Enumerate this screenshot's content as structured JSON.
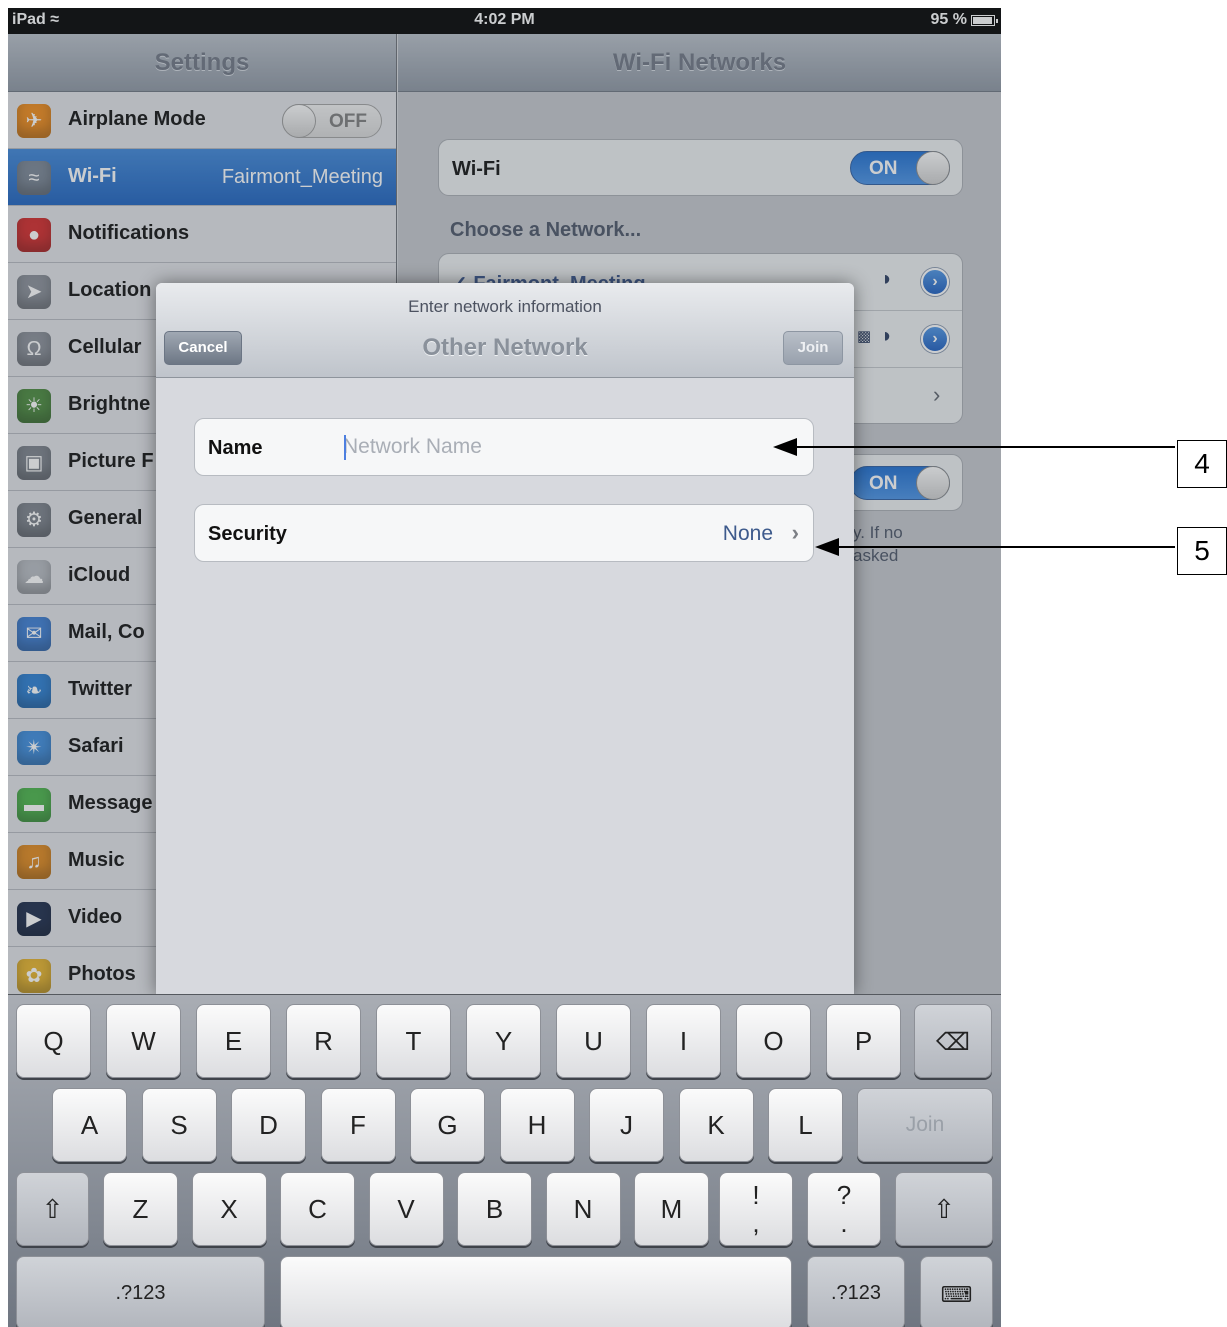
{
  "status_bar": {
    "device": "iPad",
    "time": "4:02 PM",
    "battery": "95 %"
  },
  "master": {
    "title": "Settings",
    "items": [
      {
        "label": "Airplane Mode",
        "toggle": "OFF",
        "icon": "airplane-icon",
        "color": "#f28c1a"
      },
      {
        "label": "Wi-Fi",
        "value": "Fairmont_Meeting",
        "icon": "wifi-icon",
        "color": "#7b8796",
        "selected": true
      },
      {
        "label": "Notifications",
        "icon": "notifications-icon",
        "color": "#d62a2a"
      },
      {
        "label": "Location",
        "icon": "location-icon",
        "color": "#8b9099"
      },
      {
        "label": "Cellular",
        "icon": "cellular-icon",
        "color": "#8b9099"
      },
      {
        "label": "Brightne",
        "icon": "brightness-icon",
        "color": "#4b8b3d"
      },
      {
        "label": "Picture F",
        "icon": "picture-frame-icon",
        "color": "#7d838c"
      },
      {
        "label": "General",
        "icon": "gear-icon",
        "color": "#7d838c"
      },
      {
        "label": "iCloud",
        "icon": "cloud-icon",
        "color": "#b8bcc2"
      },
      {
        "label": "Mail, Co",
        "icon": "mail-icon",
        "color": "#3d7fd6"
      },
      {
        "label": "Twitter",
        "icon": "twitter-icon",
        "color": "#2b7fd4"
      },
      {
        "label": "Safari",
        "icon": "safari-icon",
        "color": "#3e8ee0"
      },
      {
        "label": "Message",
        "icon": "messages-icon",
        "color": "#4bb64a"
      },
      {
        "label": "Music",
        "icon": "music-icon",
        "color": "#e38a1d"
      },
      {
        "label": "Video",
        "icon": "video-icon",
        "color": "#1d2c4c"
      },
      {
        "label": "Photos",
        "icon": "photos-icon",
        "color": "#e9b52b"
      }
    ]
  },
  "detail": {
    "title": "Wi-Fi Networks",
    "wifi_label": "Wi-Fi",
    "wifi_toggle": "ON",
    "choose_label": "Choose a Network...",
    "networks": [
      {
        "name": "✓ Fairmont_Meeting"
      }
    ],
    "ask_toggle": "ON",
    "footer_partial_1": "y. If no",
    "footer_partial_2": "asked"
  },
  "modal": {
    "prompt": "Enter network information",
    "title": "Other Network",
    "cancel_label": "Cancel",
    "join_label": "Join",
    "name_label": "Name",
    "name_value": "",
    "name_placeholder": "Network Name",
    "security_label": "Security",
    "security_value": "None"
  },
  "keyboard": {
    "row1": [
      "Q",
      "W",
      "E",
      "R",
      "T",
      "Y",
      "U",
      "I",
      "O",
      "P"
    ],
    "row2": [
      "A",
      "S",
      "D",
      "F",
      "G",
      "H",
      "J",
      "K",
      "L"
    ],
    "row3": [
      "Z",
      "X",
      "C",
      "V",
      "B",
      "N",
      "M"
    ],
    "punct1_top": "!",
    "punct1_bottom": ",",
    "punct2_top": "?",
    "punct2_bottom": ".",
    "join_key": "Join",
    "numbers_key": ".?123",
    "backspace_icon": "backspace-icon",
    "shift_icon": "shift-icon",
    "hide_keyboard_icon": "hide-keyboard-icon"
  },
  "callouts": {
    "name_callout": "4",
    "security_callout": "5"
  }
}
